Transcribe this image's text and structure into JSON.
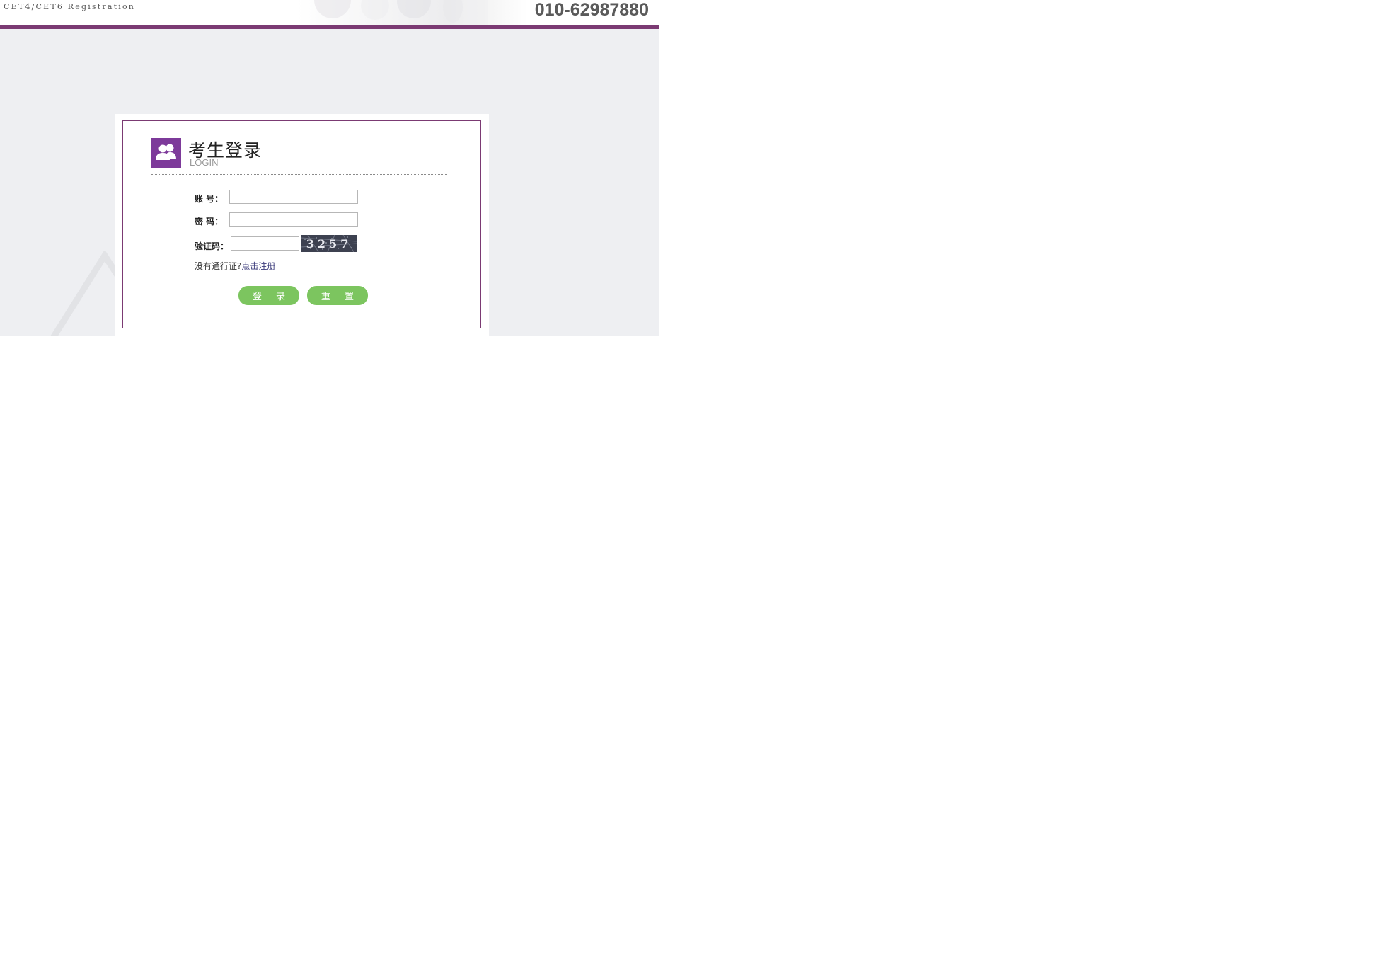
{
  "header": {
    "title": "CET4/CET6 Registration",
    "phone": "010-62987880",
    "accent_color": "#7b3a73"
  },
  "login": {
    "title": "考生登录",
    "subtitle": "LOGIN",
    "icon": "users-icon",
    "icon_color": "#7d3a9a",
    "fields": {
      "account_label": "账 号：",
      "password_label": "密 码：",
      "captcha_label": "验证码：",
      "account_value": "",
      "password_value": "",
      "captcha_value": ""
    },
    "captcha_code": "3257",
    "register_prompt": "没有通行证?",
    "register_link": "点击注册",
    "login_button": "登 录",
    "reset_button": "重 置",
    "button_color": "#7cc55f"
  }
}
